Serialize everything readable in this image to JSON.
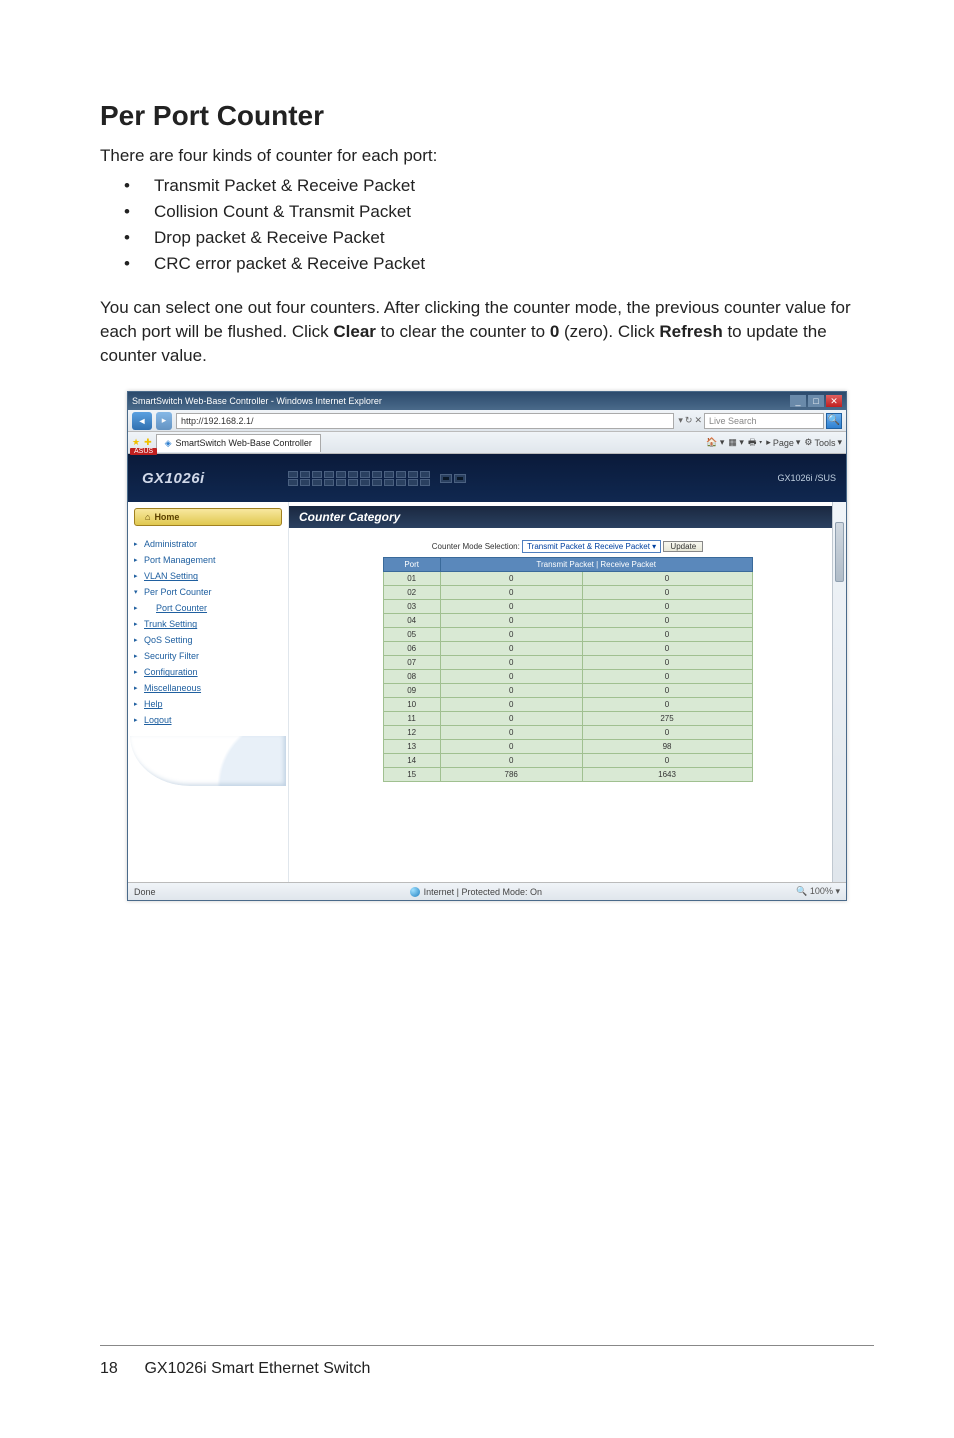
{
  "heading": "Per Port Counter",
  "intro": "There are four kinds of counter for each port:",
  "bullets": [
    "Transmit Packet & Receive Packet",
    "Collision Count & Transmit Packet",
    "Drop packet & Receive Packet",
    "CRC error packet & Receive Packet"
  ],
  "para_pre": "You can select one out four counters. After clicking the counter mode, the previous counter value for each port will be flushed. Click ",
  "para_b1": "Clear",
  "para_mid": " to clear the counter to ",
  "para_b2": "0",
  "para_mid2": " (zero). Click ",
  "para_b3": "Refresh",
  "para_end": " to update the counter value.",
  "browser": {
    "title": "SmartSwitch Web-Base Controller - Windows Internet Explorer",
    "url": "http://192.168.2.1/",
    "search_placeholder": "Live Search",
    "tab_label": "SmartSwitch Web-Base Controller",
    "menu_page": "Page",
    "menu_tools": "Tools",
    "status_done": "Done",
    "status_zone": "Internet | Protected Mode: On",
    "status_zoom": "100%"
  },
  "banner": {
    "logo": "GX1026i",
    "right": "GX1026i /SUS",
    "redtab": "ASUS"
  },
  "sidebar": {
    "home": "Home",
    "items": [
      {
        "label": "Administrator",
        "link": true,
        "underline": false
      },
      {
        "label": "Port Management",
        "link": true,
        "underline": false
      },
      {
        "label": "VLAN Setting",
        "link": true,
        "underline": true
      },
      {
        "label": "Per Port Counter",
        "link": true,
        "underline": false,
        "expand": true,
        "sub": [
          {
            "label": "Port Counter",
            "underline": true
          }
        ]
      },
      {
        "label": "Trunk Setting",
        "link": true,
        "underline": true
      },
      {
        "label": "QoS Setting",
        "link": true,
        "underline": false
      },
      {
        "label": "Security Filter",
        "link": true,
        "underline": false
      },
      {
        "label": "Configuration",
        "link": true,
        "underline": true
      },
      {
        "label": "Miscellaneous",
        "link": true,
        "underline": true
      },
      {
        "label": "Help",
        "link": true,
        "underline": true
      },
      {
        "label": "Logout",
        "link": true,
        "underline": true
      }
    ]
  },
  "content": {
    "title": "Counter Category",
    "selector_label": "Counter Mode Selection:",
    "selector_value": "Transmit Packet & Receive Packet",
    "update": "Update",
    "thead": [
      "Port",
      "Transmit Packet | Receive Packet"
    ],
    "rows": [
      {
        "p": "01",
        "a": "0",
        "b": "0"
      },
      {
        "p": "02",
        "a": "0",
        "b": "0"
      },
      {
        "p": "03",
        "a": "0",
        "b": "0"
      },
      {
        "p": "04",
        "a": "0",
        "b": "0"
      },
      {
        "p": "05",
        "a": "0",
        "b": "0"
      },
      {
        "p": "06",
        "a": "0",
        "b": "0"
      },
      {
        "p": "07",
        "a": "0",
        "b": "0"
      },
      {
        "p": "08",
        "a": "0",
        "b": "0"
      },
      {
        "p": "09",
        "a": "0",
        "b": "0"
      },
      {
        "p": "10",
        "a": "0",
        "b": "0"
      },
      {
        "p": "11",
        "a": "0",
        "b": "275"
      },
      {
        "p": "12",
        "a": "0",
        "b": "0"
      },
      {
        "p": "13",
        "a": "0",
        "b": "98"
      },
      {
        "p": "14",
        "a": "0",
        "b": "0"
      },
      {
        "p": "15",
        "a": "786",
        "b": "1643"
      }
    ]
  },
  "footer": {
    "page": "18",
    "title": "GX1026i Smart Ethernet Switch"
  }
}
